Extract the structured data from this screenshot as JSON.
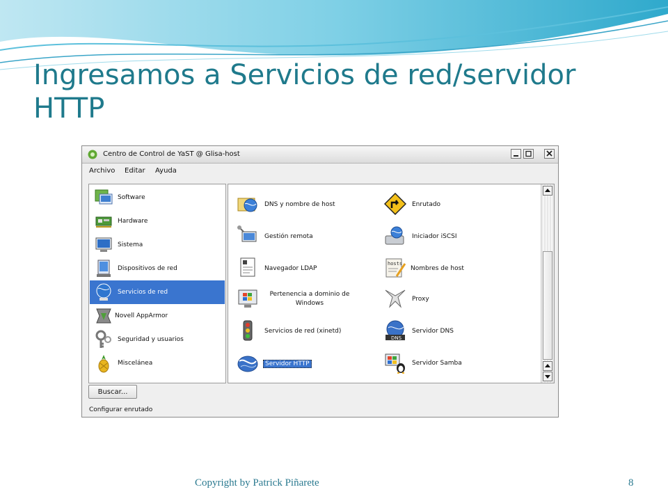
{
  "slide": {
    "title": "Ingresamos a Servicios de red/servidor HTTP",
    "footer": "Copyright by Patrick Piñarete",
    "page_number": "8"
  },
  "window": {
    "title": "Centro de Control de YaST @ Glisa-host",
    "menu": [
      "Archivo",
      "Editar",
      "Ayuda"
    ],
    "categories": [
      {
        "label": "Software",
        "icon": "software-icon"
      },
      {
        "label": "Hardware",
        "icon": "hardware-icon"
      },
      {
        "label": "Sistema",
        "icon": "system-icon"
      },
      {
        "label": "Dispositivos de red",
        "icon": "network-devices-icon"
      },
      {
        "label": "Servicios de red",
        "icon": "network-services-icon",
        "selected": true
      },
      {
        "label": "Novell AppArmor",
        "icon": "apparmor-icon"
      },
      {
        "label": "Seguridad y usuarios",
        "icon": "security-keys-icon"
      },
      {
        "label": "Misceláneа",
        "icon": "pineapple-icon"
      }
    ],
    "modules_left": [
      {
        "label": "DNS y nombre de host",
        "icon": "dns-hostname-icon"
      },
      {
        "label": "Gestión remota",
        "icon": "remote-admin-icon"
      },
      {
        "label": "Navegador LDAP",
        "icon": "ldap-browser-icon"
      },
      {
        "label": "Pertenencia a dominio de Windows",
        "icon": "windows-domain-icon"
      },
      {
        "label": "Servicios de red (xinetd)",
        "icon": "xinetd-icon"
      },
      {
        "label": "Servidor HTTP",
        "icon": "http-server-icon",
        "highlighted": true
      }
    ],
    "modules_right": [
      {
        "label": "Enrutado",
        "icon": "routing-icon"
      },
      {
        "label": "Iniciador iSCSI",
        "icon": "iscsi-icon"
      },
      {
        "label": "Nombres de host",
        "icon": "hostnames-icon"
      },
      {
        "label": "Proxy",
        "icon": "proxy-icon"
      },
      {
        "label": "Servidor DNS",
        "icon": "dns-server-icon"
      },
      {
        "label": "Servidor Samba",
        "icon": "samba-icon"
      }
    ],
    "search_button": "Buscar...",
    "status": "Configurar enrutado",
    "colors": {
      "selection": "#3a75cf",
      "title_teal": "#1f7a8c"
    }
  }
}
